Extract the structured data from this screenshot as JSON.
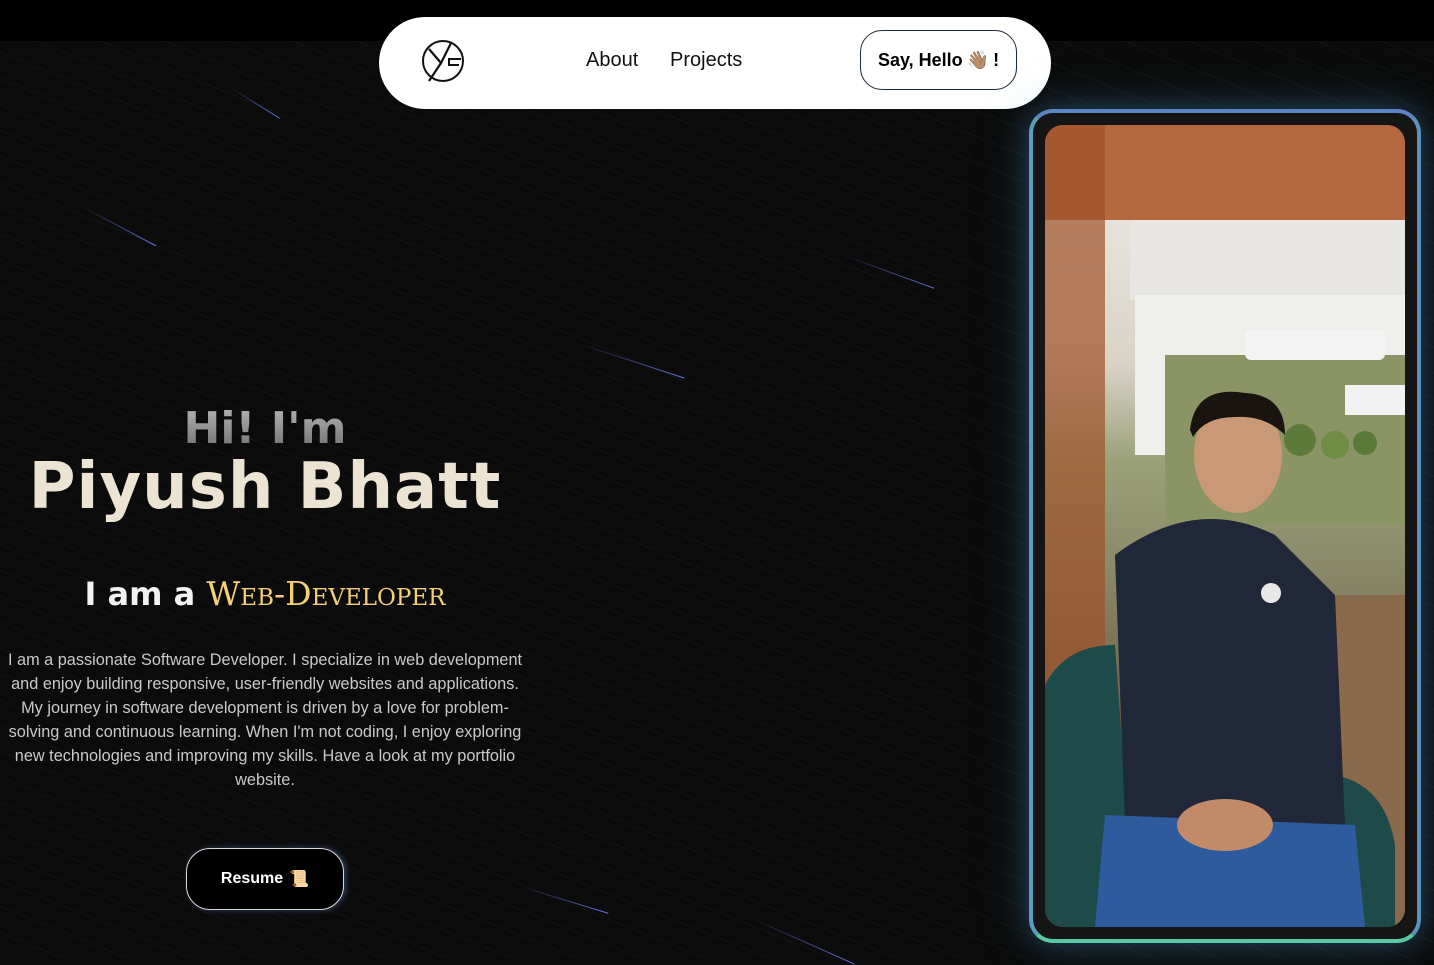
{
  "nav": {
    "logo_icon": "yg-monogram-logo-icon",
    "links": [
      {
        "label": "About"
      },
      {
        "label": "Projects"
      }
    ],
    "cta_label": "Say, Hello",
    "cta_emoji": "👋🏽",
    "cta_suffix": "!"
  },
  "hero": {
    "greeting": "Hi! I'm",
    "name": "Piyush Bhatt",
    "role_prefix": "I am a",
    "role_word": "Web-Developer",
    "intro": "I am a passionate Software Developer. I specialize in web development and enjoy building responsive, user-friendly websites and applications. My journey in software development is driven by a love for problem-solving and continuous learning. When I'm not coding, I enjoy exploring new technologies and improving my skills. Have a look at my portfolio website.",
    "resume_label": "Resume",
    "resume_emoji": "📜"
  },
  "colors": {
    "background": "#0b0b0c",
    "name": "#ece3d3",
    "role_accent": "#f5cf74",
    "frame_top": "#5b84c4",
    "frame_bottom": "#58c7a2"
  },
  "photo": {
    "icon": "profile-photo-icon"
  }
}
